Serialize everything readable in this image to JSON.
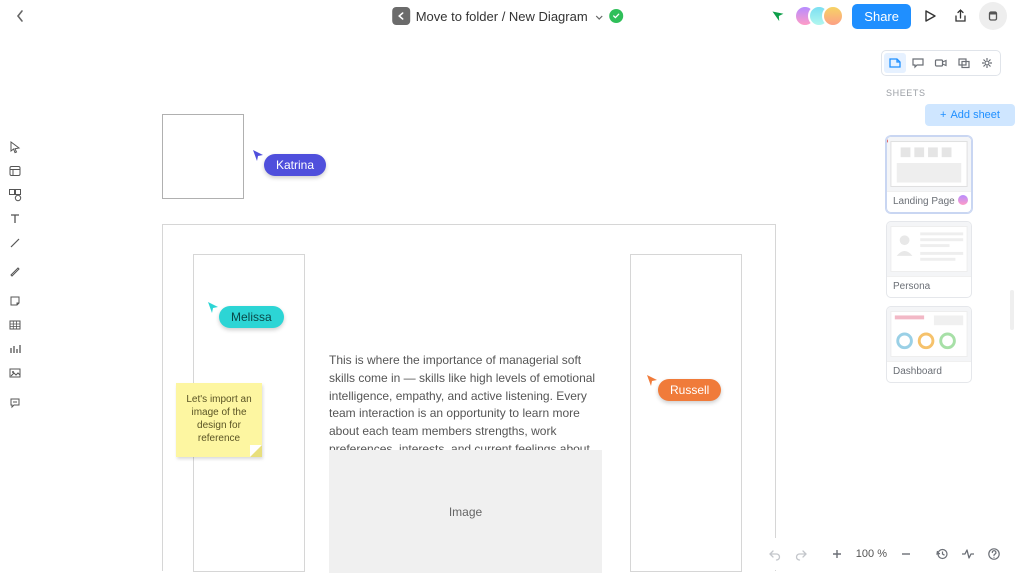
{
  "header": {
    "breadcrumb": "Move to folder / New Diagram",
    "share_label": "Share"
  },
  "cursors": {
    "katrina": "Katrina",
    "melissa": "Melissa",
    "russell": "Russell"
  },
  "sticky_note": "Let's import an image of the design for reference",
  "body_text": "This is where the importance of managerial soft skills come in — skills like high levels of emotional intelligence, empathy, and active listening. Every team interaction is an opportunity to learn more about each team members strengths, work preferences, interests, and current feelings about their work.",
  "image_placeholder": "Image",
  "right_panel": {
    "section_label": "SHEETS",
    "add_sheet_label": "Add sheet",
    "sheets": [
      {
        "title": "Landing Page"
      },
      {
        "title": "Persona"
      },
      {
        "title": "Dashboard"
      }
    ]
  },
  "bottom": {
    "zoom": "100 %"
  },
  "colors": {
    "katrina": "#4f4fdc",
    "melissa": "#2cd5d5",
    "russell": "#f07b3a",
    "primary": "#1f8fff"
  }
}
